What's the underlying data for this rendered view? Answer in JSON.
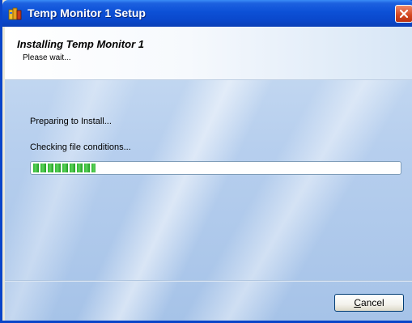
{
  "window": {
    "title": "Temp Monitor 1 Setup",
    "titlebar_color": "#0a48cc"
  },
  "header": {
    "title": "Installing Temp Monitor 1",
    "subtitle": "Please wait..."
  },
  "status": {
    "line1": "Preparing to Install...",
    "line2": "Checking file conditions..."
  },
  "progress": {
    "fraction": 0.17,
    "color": "#2eb82e"
  },
  "buttons": {
    "cancel_mnemonic": "C",
    "cancel_rest": "ancel"
  },
  "icons": {
    "app": "installer-icon",
    "close": "close-icon"
  }
}
